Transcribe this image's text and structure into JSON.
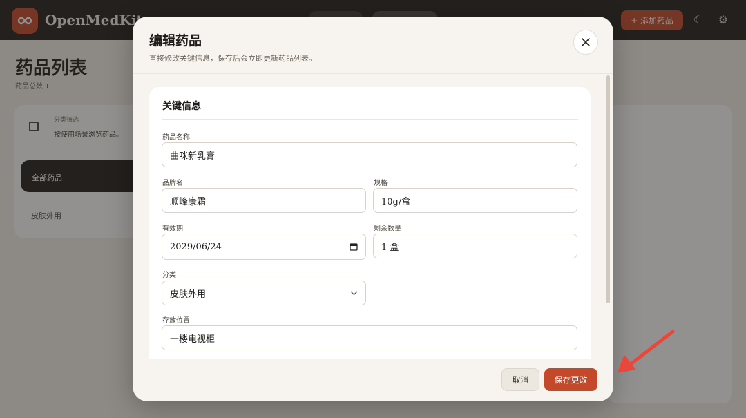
{
  "app": {
    "brand": "OpenMedKit",
    "add_button_label": "+ 添加药品",
    "page_title": "药品列表",
    "page_subtitle": "药品总数 1",
    "sidebar": {
      "header_line1": "分类筛选",
      "header_line2": "按使用场景浏览药品。",
      "active_item": "全部药品",
      "item2": "皮肤外用"
    }
  },
  "modal": {
    "title": "编辑药品",
    "description": "直接修改关键信息，保存后会立即更新药品列表。",
    "section_title": "关键信息",
    "fields": {
      "name": {
        "label": "药品名称",
        "value": "曲咪新乳膏"
      },
      "brand": {
        "label": "品牌名",
        "value": "顺峰康霜"
      },
      "spec": {
        "label": "规格",
        "value": "10g/盒"
      },
      "expiry": {
        "label": "有效期",
        "value": "2029/06/24"
      },
      "quantity": {
        "label": "剩余数量",
        "value": "1 盒"
      },
      "category": {
        "label": "分类",
        "value": "皮肤外用"
      },
      "location": {
        "label": "存放位置",
        "value": "一楼电视柜"
      }
    },
    "cancel_label": "取消",
    "save_label": "保存更改"
  },
  "colors": {
    "accent": "#c4492b",
    "annotation_arrow": "#e8473c"
  }
}
